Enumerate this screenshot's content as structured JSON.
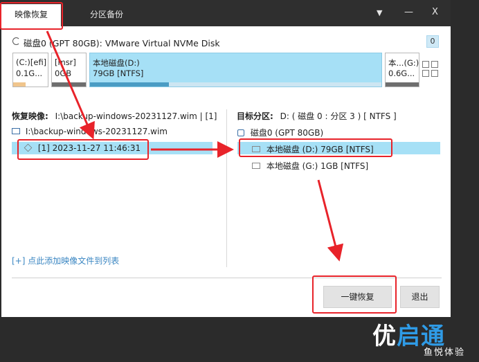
{
  "tabs": [
    {
      "label": "映像恢复",
      "active": true
    },
    {
      "label": "分区备份",
      "active": false
    }
  ],
  "window_controls": {
    "dropdown": "▼",
    "minimize": "—",
    "close": "X"
  },
  "disk": {
    "title": "磁盘0 (GPT 80GB): VMware Virtual NVMe Disk",
    "badge": "0",
    "partitions": [
      {
        "label": "(C:)[efi]",
        "size": "0.1G...",
        "used": 0.35
      },
      {
        "label": "[msr]",
        "size": "0GB",
        "used": 0
      },
      {
        "label": "本地磁盘(D:)",
        "size": "79GB [NTFS]",
        "used": 0.27
      },
      {
        "label": "本...(G:)",
        "size": "0.6G...",
        "used": 0
      }
    ]
  },
  "restore": {
    "label": "恢复映像:",
    "value": "I:\\backup-windows-20231127.wim | [1]",
    "file": "I:\\backup-windows-20231127.wim",
    "image_item": "[1] 2023-11-27 11:46:31"
  },
  "target": {
    "label": "目标分区:",
    "value": "D: ( 磁盘 0 : 分区 3 ) [ NTFS ]",
    "disk": "磁盘0 (GPT 80GB)",
    "partitions": [
      "本地磁盘 (D:) 79GB [NTFS]",
      "本地磁盘 (G:) 1GB [NTFS]"
    ]
  },
  "add_link": "[+] 点此添加映像文件到列表",
  "buttons": {
    "one_click_restore": "一键恢复",
    "exit": "退出"
  },
  "watermark": {
    "main_a": "优",
    "main_b": "启通",
    "sub": "鱼悦体验"
  },
  "colors": {
    "selection": "#a6e0f6",
    "annotation_red": "#e8232a",
    "brand_blue": "#2f9be6"
  }
}
